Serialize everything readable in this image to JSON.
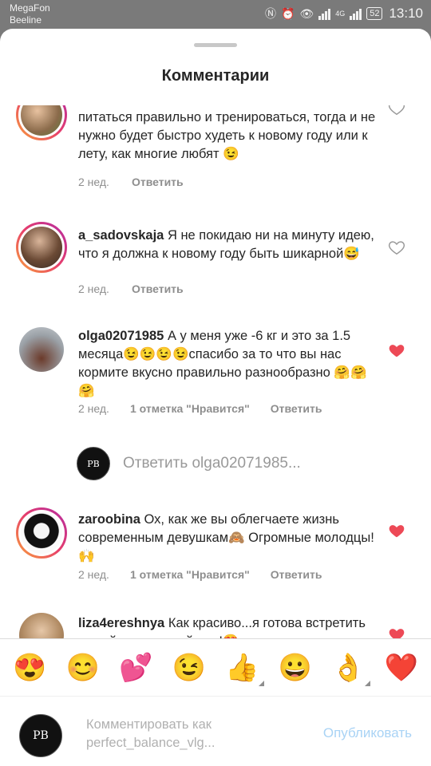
{
  "status_bar": {
    "carrier1": "MegaFon",
    "carrier2": "Beeline",
    "network": "4G",
    "battery": "52",
    "time": "13:10"
  },
  "sheet": {
    "title": "Комментарии"
  },
  "comments": [
    {
      "username": "",
      "text": "питаться правильно и тренироваться, тогда и не нужно будет быстро худеть к новому году или к лету, как многие любят 😉",
      "time": "2 нед.",
      "likes": "",
      "reply_label": "Ответить",
      "liked": false
    },
    {
      "username": "a_sadovskaja",
      "text": "Я не покидаю ни на минуту идею, что я должна к новому году быть шикарной😅",
      "time": "2 нед.",
      "likes": "",
      "reply_label": "Ответить",
      "liked": false
    },
    {
      "username": "olga02071985",
      "text": "А у меня уже -6 кг и это за 1.5 месяца😉😉😉😉спасибо за то что вы нас кормите вкусно правильно разнообразно 🤗🤗🤗",
      "time": "2 нед.",
      "likes": "1 отметка \"Нравится\"",
      "reply_label": "Ответить",
      "liked": true
    },
    {
      "username": "zaroobina",
      "text": "Ох, как же вы облегчаете жизнь современным девушкам🙈 Огромные молодцы!🙌",
      "time": "2 нед.",
      "likes": "1 отметка \"Нравится\"",
      "reply_label": "Ответить",
      "liked": true
    },
    {
      "username": "liza4ereshnya",
      "text": "Как красиво...я готова встретить новый год в вашей еде!😍",
      "time": "",
      "likes": "",
      "reply_label": "",
      "liked": true
    }
  ],
  "reply_prompt": {
    "avatar_text": "PB",
    "text": "Ответить olga02071985..."
  },
  "emoji_bar": [
    "😍",
    "😊",
    "💕",
    "😉",
    "👍",
    "😀",
    "👌",
    "❤️"
  ],
  "composer": {
    "avatar_text": "PB",
    "placeholder": "Комментировать как perfect_balance_vlg...",
    "publish_label": "Опубликовать"
  },
  "colors": {
    "like_red": "#ed4956",
    "publish_disabled": "#a9d3f5",
    "meta_gray": "#8e8e8e"
  }
}
